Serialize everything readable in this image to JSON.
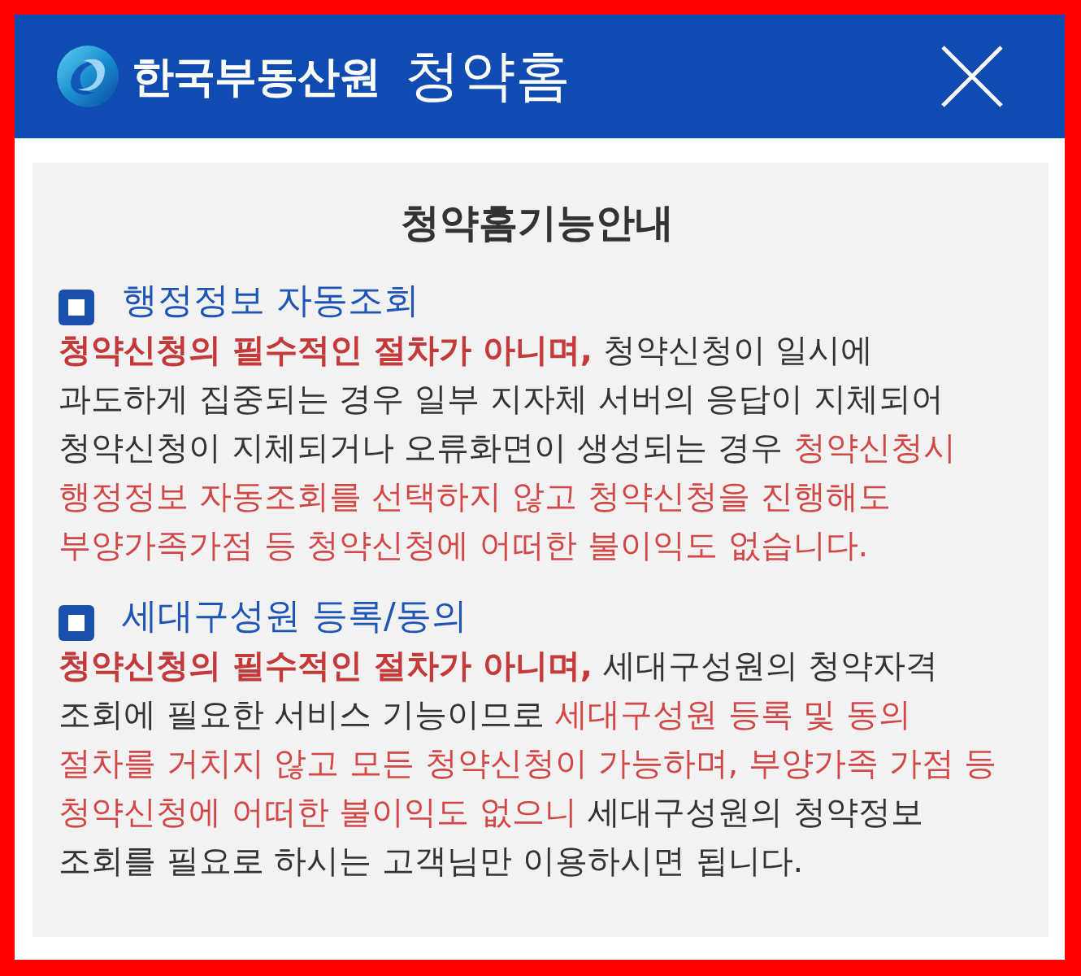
{
  "header": {
    "logo_text": "한국부동산원",
    "title": "청약홈"
  },
  "panel": {
    "title": "청약홈기능안내",
    "sections": [
      {
        "heading": "행정정보 자동조회",
        "body": [
          {
            "kind": "strong",
            "text": "청약신청의 필수적인 절차가 아니며,"
          },
          {
            "kind": "plain",
            "text": " 청약신청이 일시에 과도하게 집중되는 경우 일부 지자체 서버의 응답이 지체되어 청약신청이 지체되거나 오류화면이 생성되는 경우 "
          },
          {
            "kind": "alert",
            "text": "청약신청시 행정정보 자동조회를 선택하지 않고 청약신청을 진행해도 부양가족가점 등 청약신청에 어떠한 불이익도 없습니다."
          }
        ]
      },
      {
        "heading": "세대구성원 등록/동의",
        "body": [
          {
            "kind": "strong",
            "text": "청약신청의 필수적인 절차가 아니며,"
          },
          {
            "kind": "plain",
            "text": " 세대구성원의 청약자격 조회에 필요한 서비스 기능이므로 "
          },
          {
            "kind": "alert",
            "text": "세대구성원 등록 및 동의 절차를 거치지 않고 모든 청약신청이 가능하며, 부양가족 가점 등 청약신청에 어떠한 불이익도 없으니"
          },
          {
            "kind": "plain",
            "text": " 세대구성원의 청약정보 조회를 필요로 하시는 고객님만 이용하시면 됩니다."
          }
        ]
      }
    ]
  }
}
